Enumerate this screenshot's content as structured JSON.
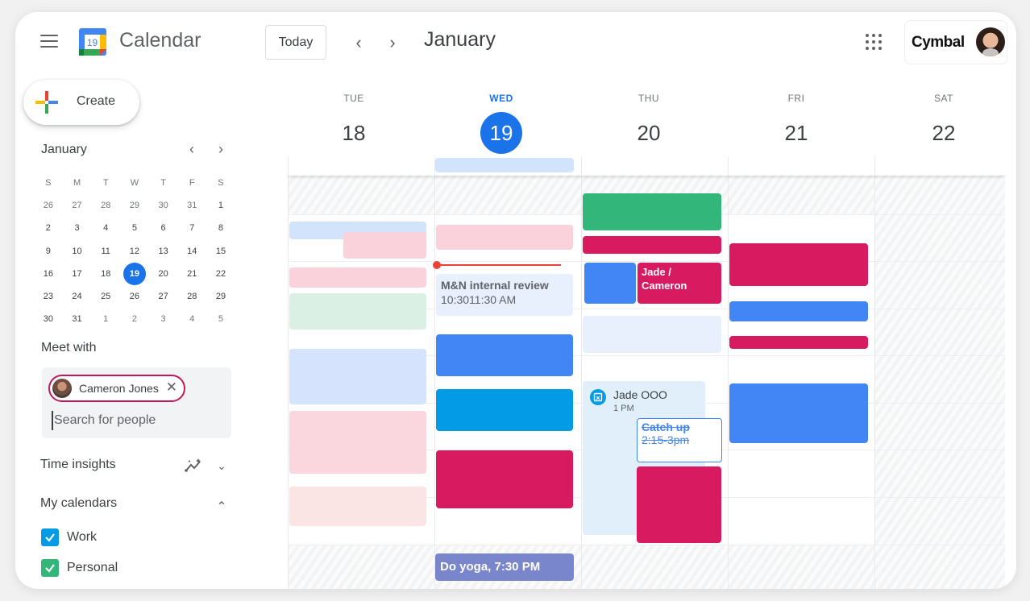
{
  "header": {
    "app_title": "Calendar",
    "logo_day": "19",
    "today_label": "Today",
    "prev_icon": "chevron-left-icon",
    "next_icon": "chevron-right-icon",
    "month_title": "January",
    "brand": "Cymbal"
  },
  "create": {
    "label": "Create"
  },
  "mini_calendar": {
    "month": "January",
    "weekday_heads": [
      "S",
      "M",
      "T",
      "W",
      "T",
      "F",
      "S"
    ],
    "weeks": [
      [
        {
          "d": "26",
          "m": true
        },
        {
          "d": "27",
          "m": true
        },
        {
          "d": "28",
          "m": true
        },
        {
          "d": "29",
          "m": true
        },
        {
          "d": "30",
          "m": true
        },
        {
          "d": "31",
          "m": true
        },
        {
          "d": "1"
        }
      ],
      [
        {
          "d": "2"
        },
        {
          "d": "3"
        },
        {
          "d": "4"
        },
        {
          "d": "5"
        },
        {
          "d": "6"
        },
        {
          "d": "7"
        },
        {
          "d": "8"
        }
      ],
      [
        {
          "d": "9"
        },
        {
          "d": "10"
        },
        {
          "d": "11"
        },
        {
          "d": "12"
        },
        {
          "d": "13"
        },
        {
          "d": "14"
        },
        {
          "d": "15"
        }
      ],
      [
        {
          "d": "16"
        },
        {
          "d": "17"
        },
        {
          "d": "18"
        },
        {
          "d": "19",
          "t": true
        },
        {
          "d": "20"
        },
        {
          "d": "21"
        },
        {
          "d": "22"
        }
      ],
      [
        {
          "d": "23"
        },
        {
          "d": "24"
        },
        {
          "d": "25"
        },
        {
          "d": "26"
        },
        {
          "d": "27"
        },
        {
          "d": "28"
        },
        {
          "d": "29"
        }
      ],
      [
        {
          "d": "30"
        },
        {
          "d": "31"
        },
        {
          "d": "1",
          "m": true
        },
        {
          "d": "2",
          "m": true
        },
        {
          "d": "3",
          "m": true
        },
        {
          "d": "4",
          "m": true
        },
        {
          "d": "5",
          "m": true
        }
      ]
    ]
  },
  "meet_with": {
    "title": "Meet with",
    "chip_name": "Cameron Jones",
    "search_placeholder": "Search for people"
  },
  "time_insights": {
    "title": "Time insights"
  },
  "my_calendars": {
    "title": "My calendars",
    "items": [
      {
        "label": "Work",
        "color": "#039be5",
        "checked": true
      },
      {
        "label": "Personal",
        "color": "#33b679",
        "checked": true
      }
    ]
  },
  "week": {
    "days": [
      {
        "dow": "TUE",
        "num": "18",
        "current": false
      },
      {
        "dow": "WED",
        "num": "19",
        "current": true
      },
      {
        "dow": "THU",
        "num": "20",
        "current": false
      },
      {
        "dow": "FRI",
        "num": "21",
        "current": false
      },
      {
        "dow": "SAT",
        "num": "22",
        "current": false
      }
    ],
    "events": {
      "mn_review_title": "M&N internal review",
      "mn_review_time": "10:3011:30 AM",
      "jade_cameron": "Jade / Cameron",
      "jade_ooo_title": "Jade OOO",
      "jade_ooo_time": "1 PM",
      "catch_up_title": "Catch up",
      "catch_up_time": "2:15-3pm",
      "yoga": "Do yoga, 7:30 PM"
    }
  },
  "colors": {
    "accent": "#1a73e8",
    "event_blue": "#4285f4",
    "event_cyan": "#039be5",
    "event_magenta": "#d81b60",
    "event_green": "#33b679",
    "event_lavender": "#7986cb",
    "now_line": "#ea4335"
  }
}
